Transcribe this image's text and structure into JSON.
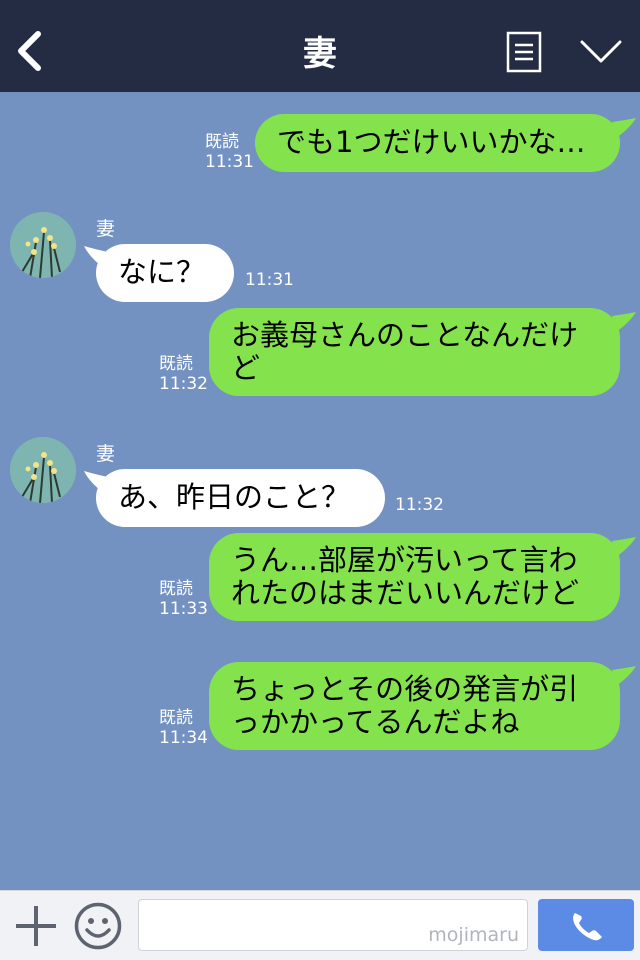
{
  "header": {
    "title": "妻",
    "back_icon": "chevron-left-icon",
    "note_icon": "note-icon",
    "menu_icon": "chevron-down-icon",
    "bg_color": "#242c44"
  },
  "chat": {
    "bg_color": "#7392c2",
    "sent_color": "#84e34d",
    "received_color": "#ffffff",
    "messages": [
      {
        "side": "right",
        "lines": [
          "でも1つだけいいかな…"
        ],
        "read": "既読",
        "time": "11:31"
      },
      {
        "side": "left",
        "sender": "妻",
        "lines": [
          "なに？"
        ],
        "time": "11:31"
      },
      {
        "side": "right",
        "lines": [
          "お義母さんのことなんだけ",
          "ど"
        ],
        "read": "既読",
        "time": "11:32"
      },
      {
        "side": "left",
        "sender": "妻",
        "lines": [
          "あ、昨日のこと？"
        ],
        "time": "11:32"
      },
      {
        "side": "right",
        "lines": [
          "うん…部屋が汚いって言わ",
          "れたのはまだいいんだけど"
        ],
        "read": "既読",
        "time": "11:33"
      },
      {
        "side": "right",
        "lines": [
          "ちょっとその後の発言が引",
          "っかかってるんだよね"
        ],
        "read": "既読",
        "time": "11:34"
      }
    ]
  },
  "inputbar": {
    "plus_icon": "plus-icon",
    "emoji_icon": "smiley-icon",
    "placeholder": "",
    "watermark": "mojimaru",
    "call_icon": "phone-icon",
    "call_color": "#5c8be5"
  }
}
